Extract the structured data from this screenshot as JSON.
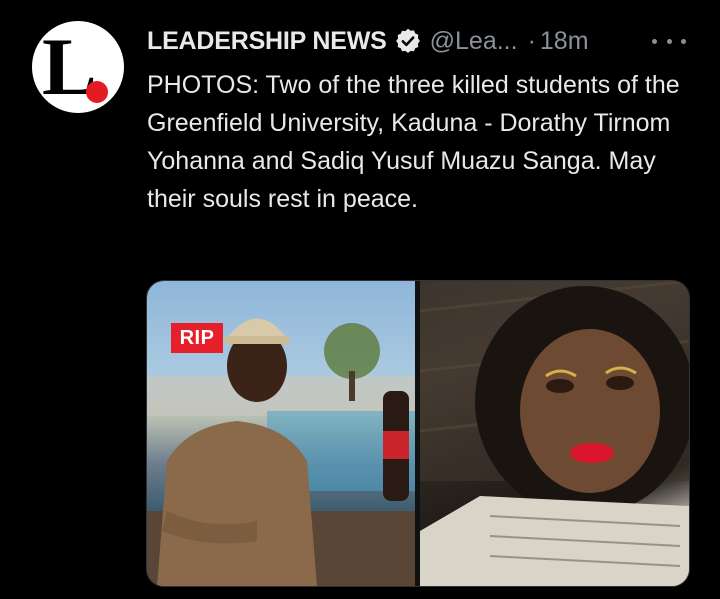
{
  "tweet": {
    "display_name": "LEADERSHIP NEWS",
    "handle": "@Lea...",
    "separator": "·",
    "time": "18m",
    "text": "PHOTOS: Two of the three killed students of the Greenfield University, Kaduna - Dorathy Tirnom Yohanna and Sadiq Yusuf Muazu Sanga. May their souls rest in peace.",
    "avatar": {
      "letter": "L",
      "accent_color": "#e41b23"
    },
    "verified_icon": "verified-badge-icon",
    "more_icon": "more-options-icon"
  },
  "media": {
    "left_photo": {
      "overlay_label": "RIP",
      "overlay_color": "#e5202a"
    },
    "right_photo": {}
  },
  "colors": {
    "background": "#000000",
    "primary_text": "#e7e9ea",
    "secondary_text": "#8b9197"
  }
}
